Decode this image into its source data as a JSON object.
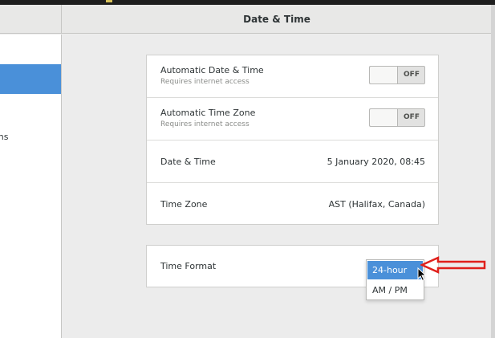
{
  "window": {
    "title": "Date & Time"
  },
  "sidebar": {
    "items": [
      {
        "label": "",
        "selected": false
      },
      {
        "label": "",
        "selected": true
      },
      {
        "label": "ions",
        "selected": false
      }
    ]
  },
  "settings": {
    "automatic_date_time": {
      "title": "Automatic Date & Time",
      "subtitle": "Requires internet access",
      "toggle_state": "OFF"
    },
    "automatic_time_zone": {
      "title": "Automatic Time Zone",
      "subtitle": "Requires internet access",
      "toggle_state": "OFF"
    },
    "date_time": {
      "title": "Date & Time",
      "value": "5 January 2020, 08:45"
    },
    "time_zone": {
      "title": "Time Zone",
      "value": "AST (Halifax, Canada)"
    },
    "time_format": {
      "title": "Time Format",
      "options": [
        "24-hour",
        "AM / PM"
      ],
      "highlighted": "24-hour"
    }
  },
  "colors": {
    "accent": "#4a90d9",
    "annotation_arrow": "#e0201b"
  }
}
